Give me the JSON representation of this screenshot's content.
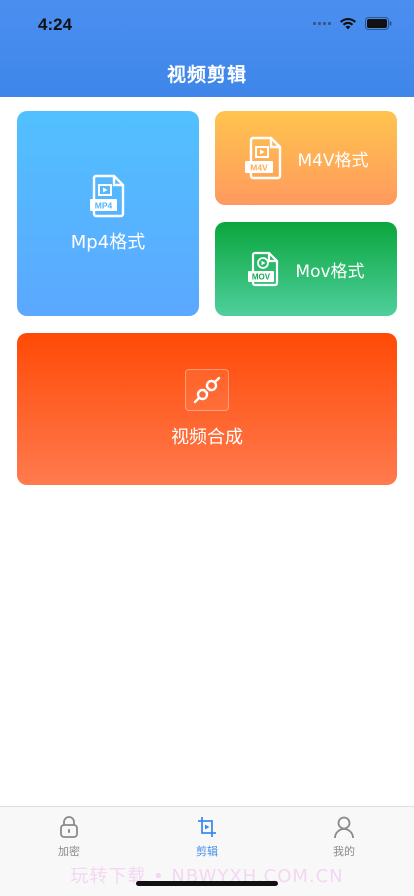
{
  "status_bar": {
    "time": "4:24"
  },
  "header": {
    "title": "视频剪辑"
  },
  "cards": {
    "mp4": {
      "label": "Mp4格式",
      "badge": "MP4"
    },
    "m4v": {
      "label": "M4V格式",
      "badge": "M4V"
    },
    "mov": {
      "label": "Mov格式",
      "badge": "MOV"
    },
    "merge": {
      "label": "视频合成"
    }
  },
  "tabbar": {
    "items": [
      {
        "label": "加密",
        "icon": "lock-icon"
      },
      {
        "label": "剪辑",
        "icon": "crop-icon",
        "active": true
      },
      {
        "label": "我的",
        "icon": "user-icon"
      }
    ]
  },
  "watermark": "玩转下载 • NBWYXH.COM.CN",
  "colors": {
    "header": "#4a8ff0",
    "tab_active": "#3d8ce8",
    "mp4": "#52c0ff",
    "m4v": "#ffb357",
    "mov": "#0aa63c",
    "merge": "#ff4a06"
  }
}
